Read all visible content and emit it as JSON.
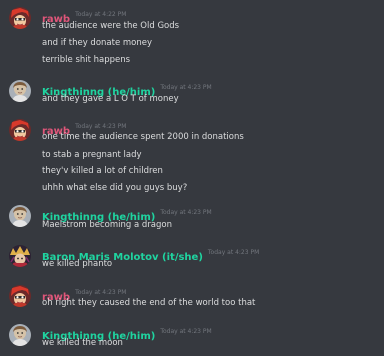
{
  "colors": {
    "background": "#36393f",
    "message_text": "#dcddde",
    "timestamp": "#72767d",
    "rawb": "#e0567a",
    "kingthinng": "#1fd4a0",
    "baron": "#1fd4a0"
  },
  "messages": [
    {
      "author": "rawb",
      "avatar": "rawb-avatar-icon",
      "timestamp": "Today at 4:22 PM",
      "lines": [
        "the audience were the Old Gods",
        "and if they donate money",
        "terrible shit happens"
      ]
    },
    {
      "author": "Kingthinng (he/him)",
      "avatar": "kingthinng-avatar-icon",
      "timestamp": "Today at 4:23 PM",
      "lines": [
        "and they gave a L O T of money"
      ]
    },
    {
      "author": "rawb",
      "avatar": "rawb-avatar-icon",
      "timestamp": "Today at 4:23 PM",
      "lines": [
        "one time the audience spent 2000 in donations",
        "to stab a pregnant lady",
        "they'v killed a lot of children",
        "uhhh what else did you guys buy?"
      ]
    },
    {
      "author": "Kingthinng (he/him)",
      "avatar": "kingthinng-avatar-icon",
      "timestamp": "Today at 4:23 PM",
      "lines": [
        "Maelstrom becoming a dragon"
      ]
    },
    {
      "author": "Baron Maris Molotov (it/she)",
      "avatar": "baron-avatar-icon",
      "timestamp": "Today at 4:23 PM",
      "lines": [
        "we killed phanto"
      ]
    },
    {
      "author": "rawb",
      "avatar": "rawb-avatar-icon",
      "timestamp": "Today at 4:23 PM",
      "lines": [
        "oh right they caused the end of the world too that"
      ]
    },
    {
      "author": "Kingthinng (he/him)",
      "avatar": "kingthinng-avatar-icon",
      "timestamp": "Today at 4:23 PM",
      "lines": [
        "we killed the moon"
      ]
    }
  ]
}
